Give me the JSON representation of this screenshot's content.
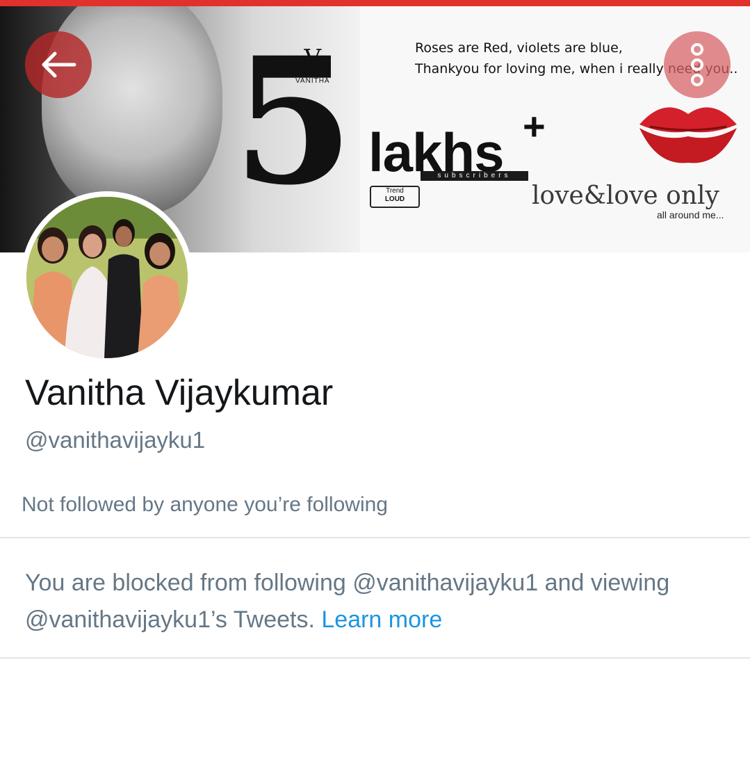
{
  "header": {
    "accent_color": "#e0312a",
    "back_icon": "arrow-left-icon",
    "more_icon": "more-vertical-icon"
  },
  "banner": {
    "brand_name": "VANITHA",
    "milestone_number": "5",
    "milestone_word": "lakhs",
    "milestone_plus": "+",
    "milestone_sub": "subscribers",
    "badge_top": "Trend",
    "badge_bottom": "LOUD",
    "poem_line1": "Roses are Red, violets are blue,",
    "poem_line2": "Thankyou for loving me, when i really need you..",
    "love_text": "love&love only",
    "love_sub": "all around me..."
  },
  "profile": {
    "name": "Vanitha Vijaykumar",
    "handle": "@vanithavijayku1",
    "followed_by": "Not followed by anyone you’re following",
    "blocked_prefix": "You are blocked from following @vanithavijayku1 and viewing @vanithavijayku1’s Tweets.",
    "learn_more": "Learn more",
    "link_color": "#1b95e0",
    "secondary_text_color": "#657786"
  }
}
